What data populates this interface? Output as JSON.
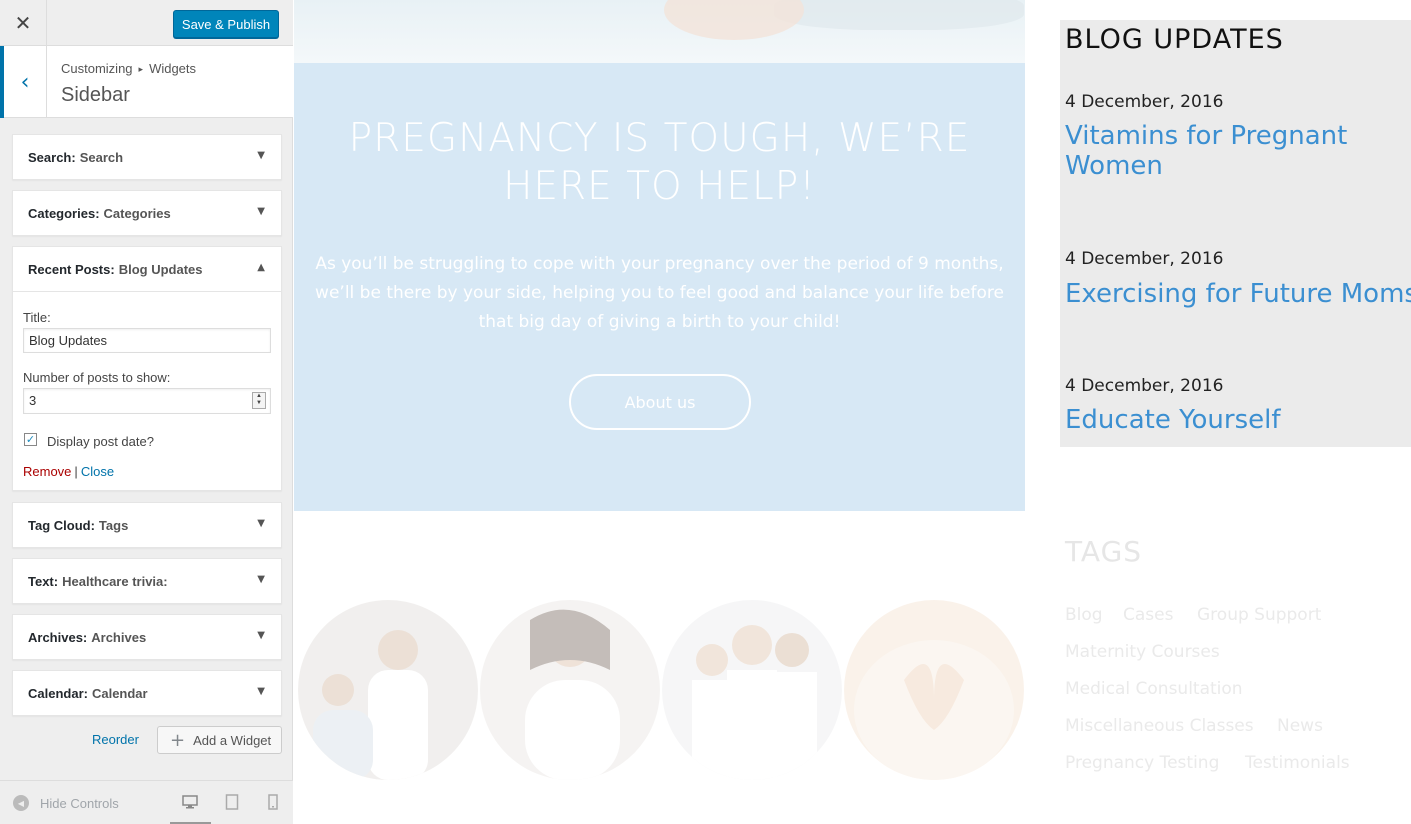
{
  "customizer": {
    "close_icon": "close-icon",
    "save_publish": "Save & Publish",
    "breadcrumb": {
      "root": "Customizing",
      "separator": "▸",
      "current": "Widgets"
    },
    "section_title": "Sidebar",
    "widgets": [
      {
        "type": "Search:",
        "title": "Search",
        "expanded": false
      },
      {
        "type": "Categories:",
        "title": "Categories",
        "expanded": false
      },
      {
        "type": "Recent Posts:",
        "title": "Blog Updates",
        "expanded": true
      },
      {
        "type": "Tag Cloud:",
        "title": "Tags",
        "expanded": false
      },
      {
        "type": "Text:",
        "title": "Healthcare trivia:",
        "expanded": false
      },
      {
        "type": "Archives:",
        "title": "Archives",
        "expanded": false
      },
      {
        "type": "Calendar:",
        "title": "Calendar",
        "expanded": false
      }
    ],
    "recent_posts_form": {
      "title_label": "Title:",
      "title_value": "Blog Updates",
      "number_label": "Number of posts to show:",
      "number_value": "3",
      "display_date_label": "Display post date?",
      "display_date_checked": true,
      "remove": "Remove",
      "separator": "|",
      "close": "Close"
    },
    "reorder": "Reorder",
    "add_widget": "Add a Widget",
    "hide_controls": "Hide Controls",
    "accent_color": "#0073aa",
    "button_color": "#0085ba"
  },
  "preview": {
    "banner": {
      "title": "PREGNANCY IS TOUGH, WE’RE HERE TO HELP!",
      "text": "As you’ll be struggling to cope with your pregnancy over the period of 9 months, we’ll be there by your side, helping you to feel good and balance your life before that big day of giving a birth to your child!",
      "button": "About us",
      "background_color": "#d7e8f5"
    },
    "blog": {
      "title": "BLOG UPDATES",
      "posts": [
        {
          "date": "4 December, 2016",
          "title": "Vitamins for Pregnant Women"
        },
        {
          "date": "4 December, 2016",
          "title": "Exercising for Future Moms"
        },
        {
          "date": "4 December, 2016",
          "title": "Educate Yourself"
        }
      ],
      "link_color": "#3b8fd1"
    },
    "tags": {
      "title": "TAGS",
      "items": [
        "Blog",
        "Cases",
        "Group Support",
        "Maternity Courses",
        "Medical Consultation",
        "Miscellaneous Classes",
        "News",
        "Pregnancy Testing",
        "Testimonials"
      ]
    }
  }
}
